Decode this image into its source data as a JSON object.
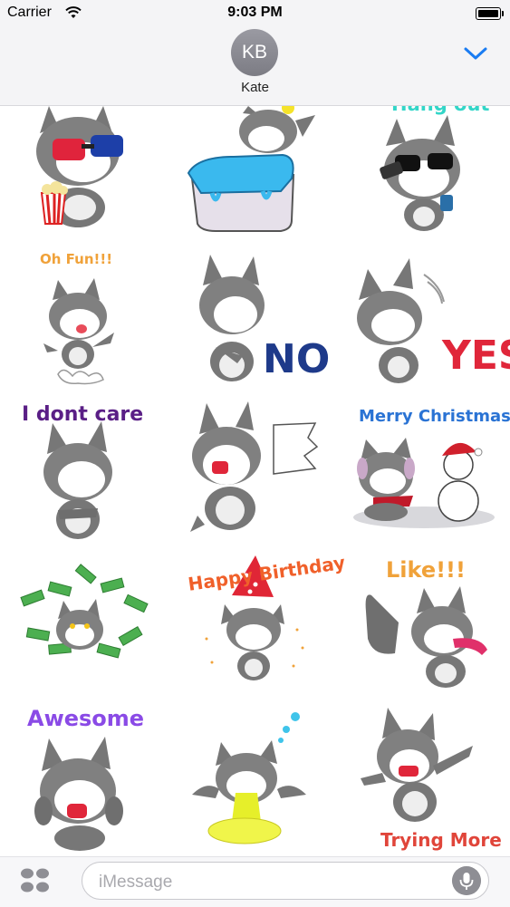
{
  "status_bar": {
    "carrier": "Carrier",
    "time": "9:03 PM",
    "icons": [
      "wifi-icon",
      "battery-icon"
    ]
  },
  "header": {
    "avatar_initials": "KB",
    "contact_name": "Kate",
    "collapse_icon": "chevron-down-icon",
    "accent_color": "#1a7cf2"
  },
  "stickers": [
    {
      "caption": "",
      "subject": "husky with 3d glasses and popcorn"
    },
    {
      "caption": "",
      "subject": "husky in bathtub"
    },
    {
      "caption": "Hang out",
      "subject": "husky with sunglasses and phone"
    },
    {
      "caption": "Oh Fun!!!",
      "subject": "husky jumping"
    },
    {
      "caption": "NO",
      "subject": "husky saying no"
    },
    {
      "caption": "YES",
      "subject": "husky saying yes"
    },
    {
      "caption": "I dont care",
      "subject": "husky arms crossed"
    },
    {
      "caption": "",
      "subject": "husky shouting"
    },
    {
      "caption": "Merry Christmas",
      "subject": "husky with snowman"
    },
    {
      "caption": "",
      "subject": "husky with money"
    },
    {
      "caption": "Happy Birthday",
      "subject": "husky with party hat"
    },
    {
      "caption": "Like!!!",
      "subject": "husky thumbs up"
    },
    {
      "caption": "Awesome",
      "subject": "husky happy"
    },
    {
      "caption": "",
      "subject": "husky vomiting"
    },
    {
      "caption": "Trying More",
      "subject": "husky pushing"
    }
  ],
  "compose": {
    "placeholder": "iMessage",
    "icons": [
      "app-drawer-icon",
      "microphone-icon"
    ]
  }
}
